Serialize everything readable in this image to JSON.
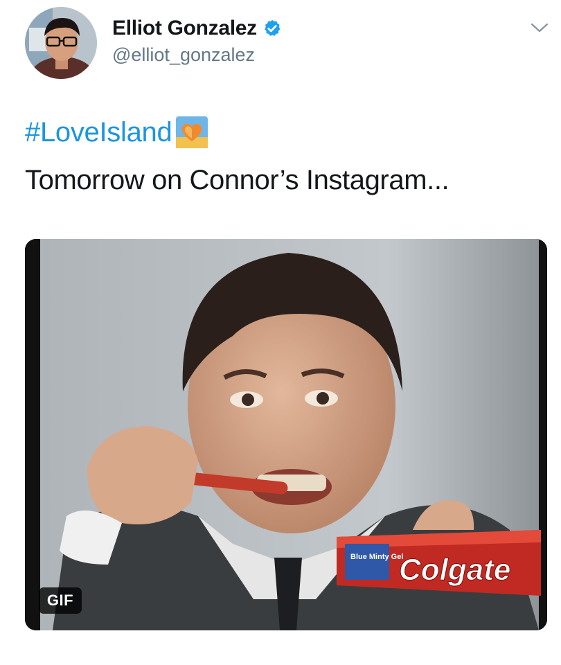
{
  "tweet": {
    "author": {
      "display_name": "Elliot Gonzalez",
      "handle": "@elliot_gonzalez",
      "verified": true
    },
    "hashtag": "#LoveIsland",
    "text": "Tomorrow on Connor’s Instagram...",
    "media": {
      "type_badge": "GIF",
      "product_label": "Colgate",
      "product_sublabel": "Blue Minty Gel"
    }
  },
  "colors": {
    "link": "#1b95e0",
    "secondary_text": "#657786",
    "verified_badge": "#1da1f2"
  },
  "icons": {
    "verified": "verified-badge-icon",
    "menu": "chevron-down-icon",
    "hashflag": "love-island-heart-icon"
  }
}
